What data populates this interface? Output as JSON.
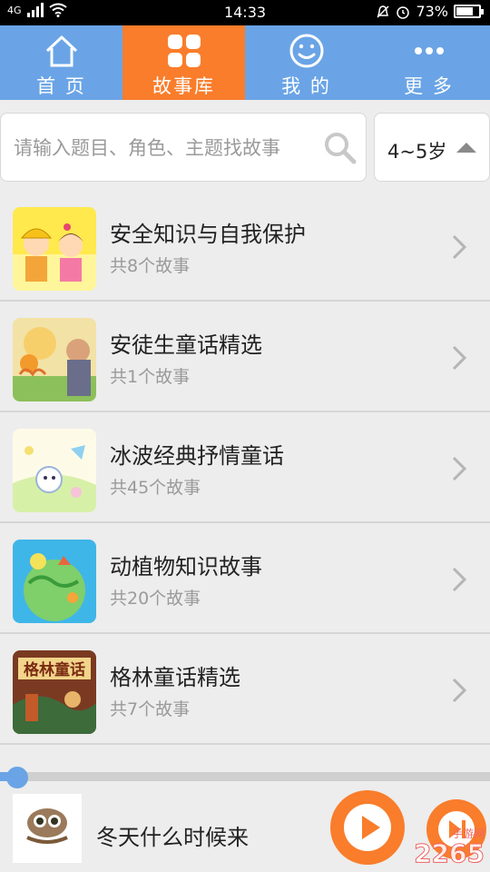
{
  "status_bar": {
    "time": "14:33",
    "signal": "4G",
    "battery_percent": "73%",
    "battery_level": 0.73
  },
  "tabs": [
    {
      "label": "首 页",
      "icon": "home-icon",
      "active": false
    },
    {
      "label": "故事库",
      "icon": "grid-icon",
      "active": true
    },
    {
      "label": "我 的",
      "icon": "smiley-icon",
      "active": false
    },
    {
      "label": "更 多",
      "icon": "more-dots-icon",
      "active": false
    }
  ],
  "search": {
    "placeholder": "请输入题目、角色、主题找故事",
    "value": ""
  },
  "age_filter": {
    "selected": "4~5岁"
  },
  "categories": [
    {
      "title": "安全知识与自我保护",
      "count": "共8个故事"
    },
    {
      "title": "安徒生童话精选",
      "count": "共1个故事"
    },
    {
      "title": "冰波经典抒情童话",
      "count": "共45个故事"
    },
    {
      "title": "动植物知识故事",
      "count": "共20个故事"
    },
    {
      "title": "格林童话精选",
      "count": "共7个故事"
    }
  ],
  "player": {
    "now_playing": "冬天什么时候来",
    "progress": 0.035
  },
  "watermark": {
    "text": "2265",
    "sub": "手游网"
  },
  "colors": {
    "tab_bar": "#6aa4e6",
    "tab_active": "#f97d2b",
    "accent_orange": "#f97d2b"
  }
}
